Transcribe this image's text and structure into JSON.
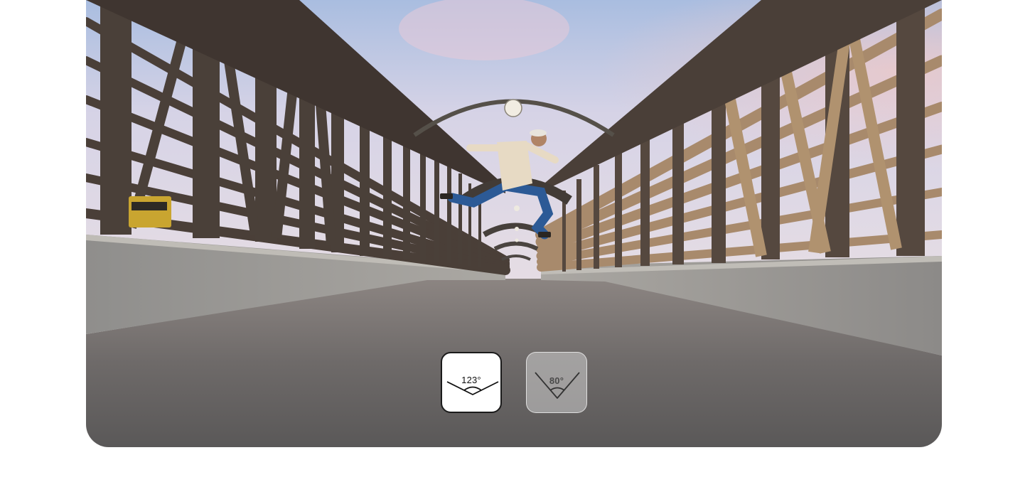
{
  "lens_options": [
    {
      "label": "123°",
      "icon": "wide-angle-icon",
      "selected": true
    },
    {
      "label": "80°",
      "icon": "standard-angle-icon",
      "selected": false
    }
  ],
  "colors": {
    "selected_bg": "#ffffff",
    "selected_border": "#1b1b1b",
    "unselected_bg": "#cdcdcd"
  }
}
